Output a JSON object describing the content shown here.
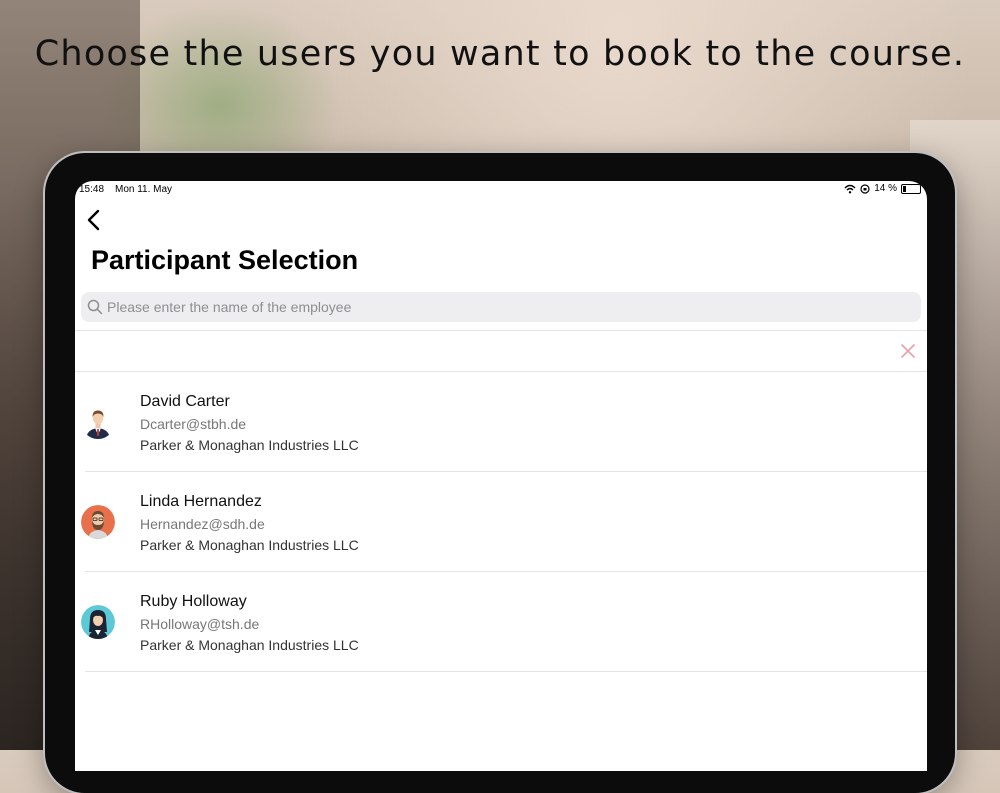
{
  "headline": "Choose the users you want to book to the course.",
  "status_bar": {
    "time": "15:48",
    "date": "Mon 11. May",
    "battery": "14 %"
  },
  "page": {
    "title": "Participant Selection"
  },
  "search": {
    "placeholder": "Please enter the name of the employee",
    "value": ""
  },
  "participants": [
    {
      "name": "David  Carter",
      "email": "Dcarter@stbh.de",
      "company": "Parker & Monaghan Industries LLC",
      "avatar": "man-in-suit-avatar"
    },
    {
      "name": "Linda Hernandez",
      "email": "Hernandez@sdh.de",
      "company": "Parker & Monaghan Industries LLC",
      "avatar": "bearded-man-avatar"
    },
    {
      "name": "Ruby Holloway",
      "email": "RHolloway@tsh.de",
      "company": "Parker & Monaghan Industries LLC",
      "avatar": "woman-avatar"
    }
  ],
  "colors": {
    "clear_icon": "#e8a0aa",
    "avatar_orange": "#e8704a",
    "avatar_teal": "#5cc9d6",
    "search_bg": "#eeeef0"
  }
}
